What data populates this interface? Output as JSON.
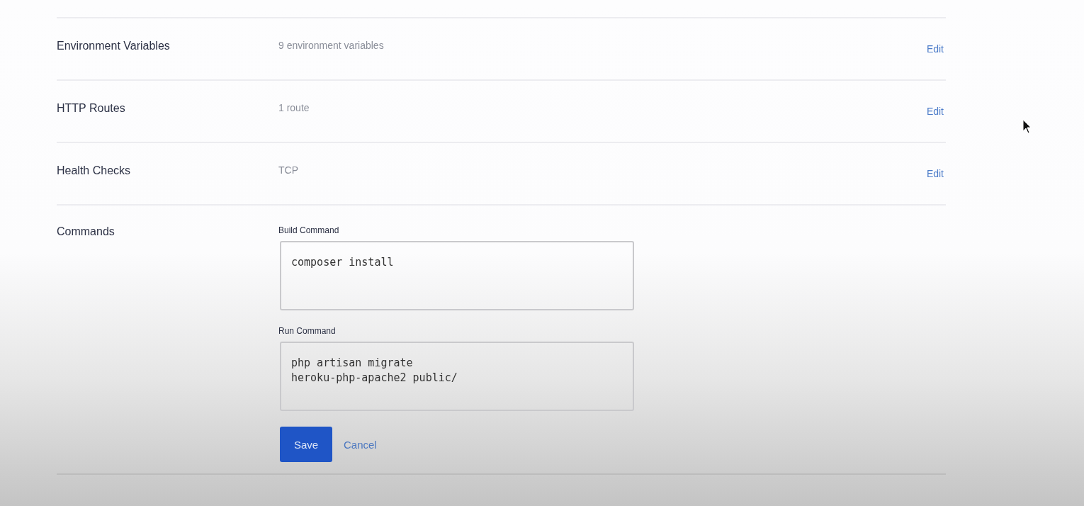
{
  "settings": [
    {
      "label": "Environment Variables",
      "value": "9 environment variables",
      "action": "Edit"
    },
    {
      "label": "HTTP Routes",
      "value": "1 route",
      "action": "Edit"
    },
    {
      "label": "Health Checks",
      "value": "TCP",
      "action": "Edit"
    }
  ],
  "commands": {
    "label": "Commands",
    "fields": [
      {
        "label": "Build Command",
        "value": "composer install"
      },
      {
        "label": "Run Command",
        "value": "php artisan migrate\nheroku-php-apache2 public/"
      }
    ],
    "buttons": [
      {
        "label": "Save",
        "kind": "primary"
      },
      {
        "label": "Cancel",
        "kind": "link"
      }
    ]
  }
}
